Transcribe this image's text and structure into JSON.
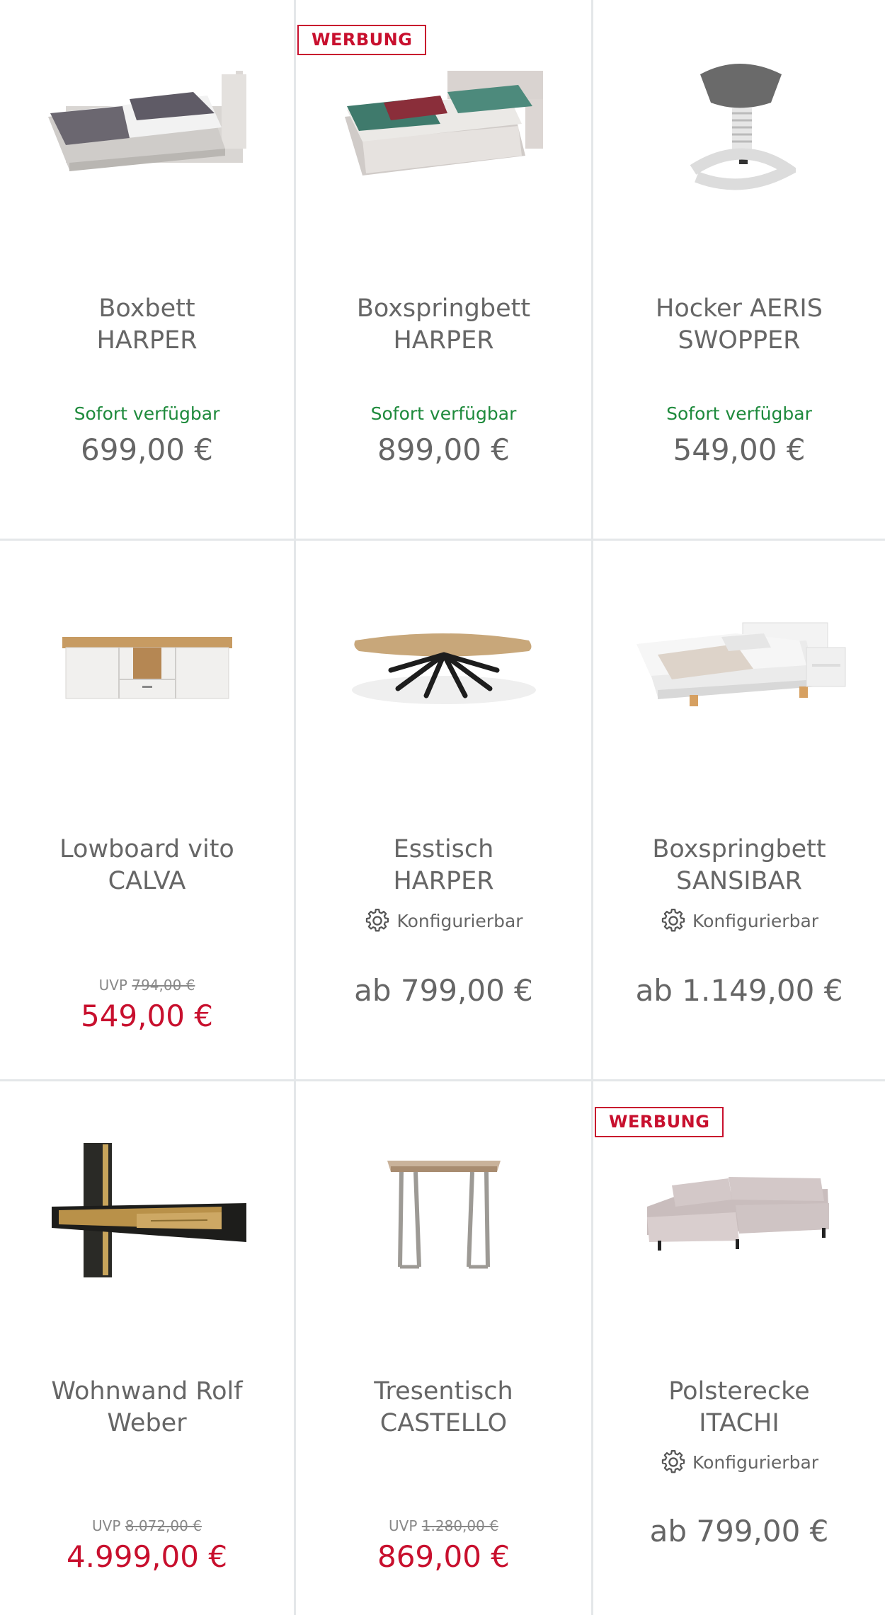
{
  "badge_label": "WERBUNG",
  "config_label": "Konfigurierbar",
  "colors": {
    "accent_red": "#c8102e",
    "availability_green": "#1e8a3c",
    "text_gray": "#666666",
    "divider": "#e4e7e9"
  },
  "products": [
    {
      "title_line1": "Boxbett",
      "title_line2": "HARPER",
      "availability": "Sofort verfügbar",
      "price": "699,00 €",
      "icon": "boxbed-image"
    },
    {
      "title_line1": "Boxspringbett",
      "title_line2": "HARPER",
      "availability": "Sofort verfügbar",
      "price": "899,00 €",
      "icon": "boxspring-bed-image",
      "badge": true
    },
    {
      "title_line1": "Hocker AERIS",
      "title_line2": "SWOPPER",
      "availability": "Sofort verfügbar",
      "price": "549,00 €",
      "icon": "stool-image"
    },
    {
      "title_line1": "Lowboard vito",
      "title_line2": "CALVA",
      "uvp_label": "UVP",
      "uvp_price": "794,00 €",
      "price": "549,00 €",
      "icon": "lowboard-image"
    },
    {
      "title_line1": "Esstisch",
      "title_line2": "HARPER",
      "configurable": true,
      "price": "ab 799,00 €",
      "icon": "dining-table-image"
    },
    {
      "title_line1": "Boxspringbett",
      "title_line2": "SANSIBAR",
      "configurable": true,
      "price": "ab 1.149,00 €",
      "icon": "bed-set-image"
    },
    {
      "title_line1": "Wohnwand Rolf",
      "title_line2": "Weber",
      "uvp_label": "UVP",
      "uvp_price": "8.072,00 €",
      "price": "4.999,00 €",
      "icon": "wall-unit-image"
    },
    {
      "title_line1": "Tresentisch",
      "title_line2": "CASTELLO",
      "uvp_label": "UVP",
      "uvp_price": "1.280,00 €",
      "price": "869,00 €",
      "icon": "bar-table-image"
    },
    {
      "title_line1": "Polsterecke",
      "title_line2": "ITACHI",
      "configurable": true,
      "price": "ab 799,00 €",
      "icon": "corner-sofa-image",
      "badge": true
    }
  ]
}
